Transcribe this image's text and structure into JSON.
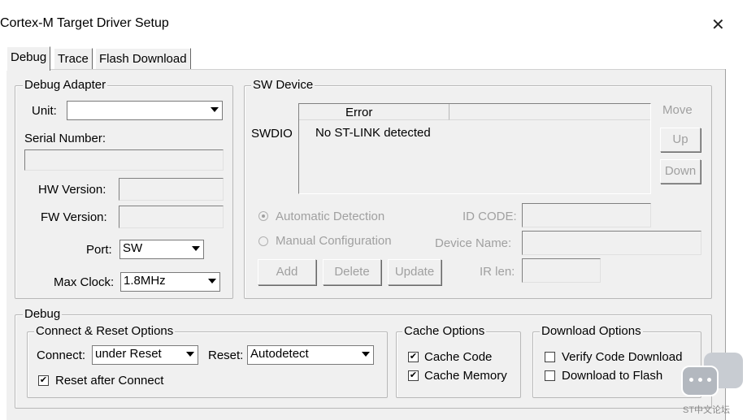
{
  "window": {
    "title": "Cortex-M Target Driver Setup",
    "close_glyph": "✕"
  },
  "tabs": [
    {
      "label": "Debug",
      "active": true
    },
    {
      "label": "Trace",
      "active": false
    },
    {
      "label": "Flash Download",
      "active": false
    }
  ],
  "debug_adapter": {
    "legend": "Debug Adapter",
    "unit_label": "Unit:",
    "unit_value": "",
    "serial_label": "Serial Number:",
    "serial_value": "",
    "hw_label": "HW Version:",
    "hw_value": "",
    "fw_label": "FW Version:",
    "fw_value": "",
    "port_label": "Port:",
    "port_value": "SW",
    "clock_label": "Max Clock:",
    "clock_value": "1.8MHz"
  },
  "sw_device": {
    "legend": "SW Device",
    "row_label": "SWDIO",
    "columns": [
      "Error",
      ""
    ],
    "rows": [
      [
        "No ST-LINK detected",
        ""
      ]
    ],
    "move_label": "Move",
    "up_label": "Up",
    "down_label": "Down",
    "auto_label": "Automatic Detection",
    "manual_label": "Manual Configuration",
    "idcode_label": "ID CODE:",
    "devname_label": "Device Name:",
    "irlen_label": "IR len:",
    "add_label": "Add",
    "delete_label": "Delete",
    "update_label": "Update"
  },
  "debug": {
    "legend": "Debug",
    "connect_reset": {
      "legend": "Connect & Reset Options",
      "connect_label": "Connect:",
      "connect_value": "under Reset",
      "reset_label": "Reset:",
      "reset_value": "Autodetect",
      "reset_after_label": "Reset after Connect",
      "reset_after_checked": true
    },
    "cache": {
      "legend": "Cache Options",
      "code_label": "Cache Code",
      "code_checked": true,
      "memory_label": "Cache Memory",
      "memory_checked": true
    },
    "download": {
      "legend": "Download Options",
      "verify_label": "Verify Code Download",
      "verify_checked": false,
      "flash_label": "Download to Flash",
      "flash_checked": false
    }
  },
  "watermark": {
    "text": "ST中文论坛",
    "icon": "chat-bubble-icon"
  },
  "colors": {
    "panel": "#f0f0f0",
    "disabled_text": "#a0a0a0",
    "border": "#b8b8b8"
  }
}
